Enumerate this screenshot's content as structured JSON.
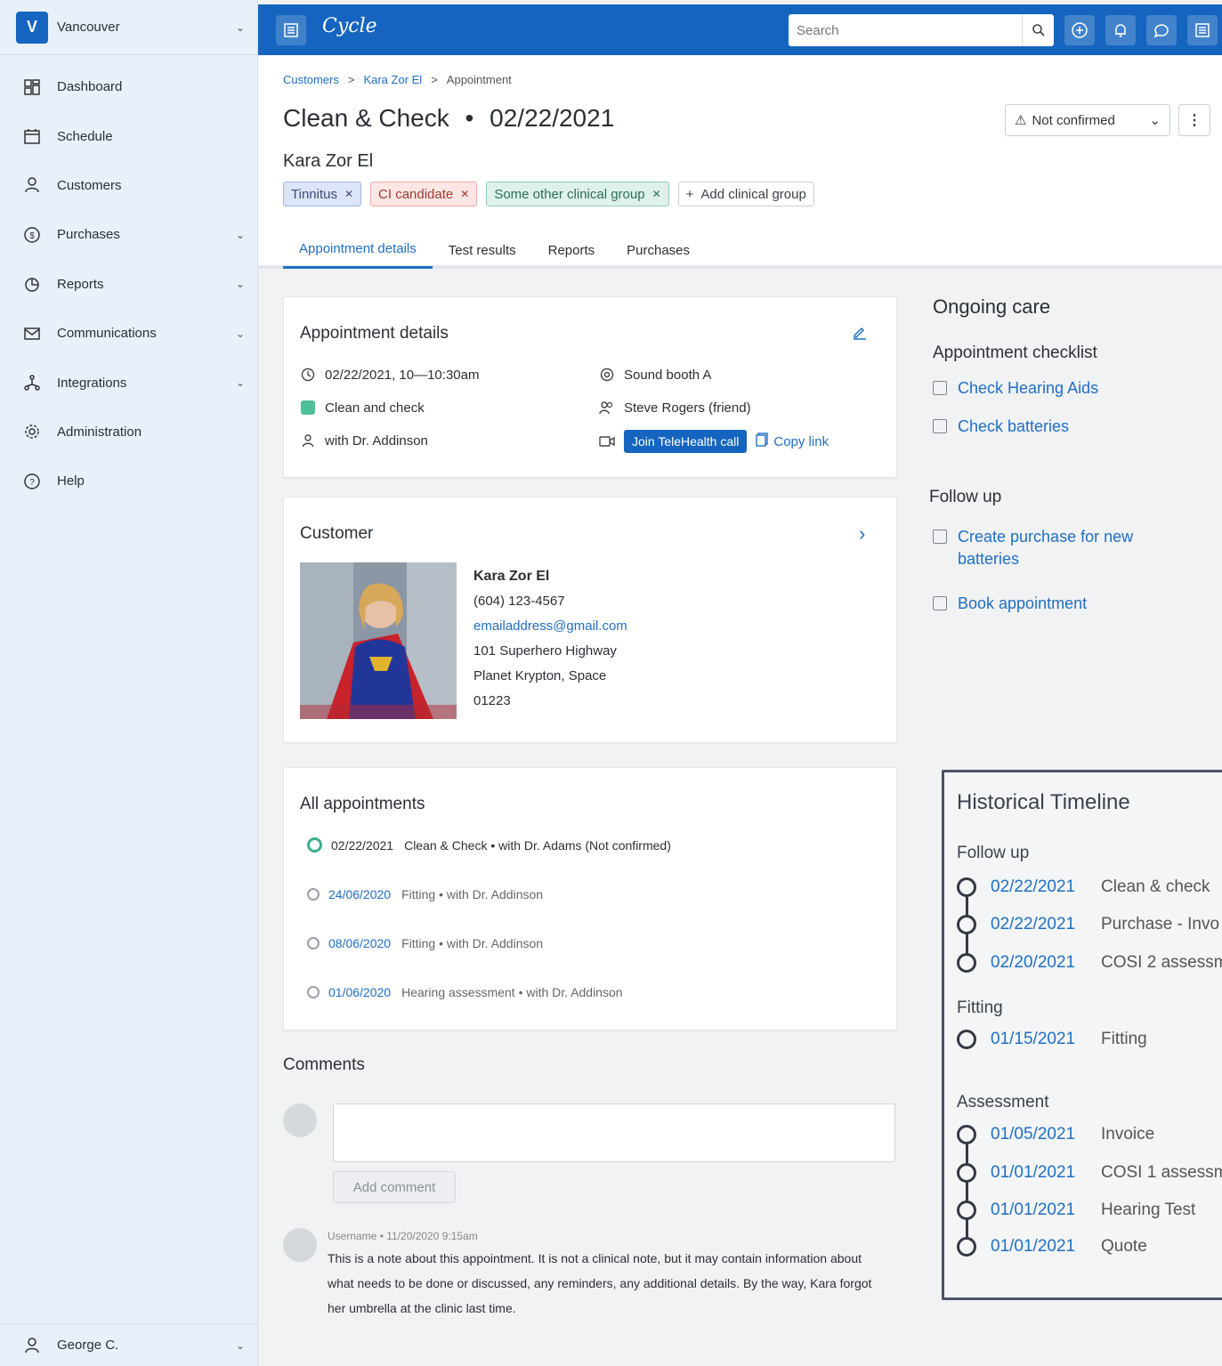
{
  "sidebar": {
    "location_badge": "V",
    "location_name": "Vancouver",
    "items": [
      {
        "label": "Dashboard"
      },
      {
        "label": "Schedule"
      },
      {
        "label": "Customers"
      },
      {
        "label": "Purchases"
      },
      {
        "label": "Reports"
      },
      {
        "label": "Communications"
      },
      {
        "label": "Integrations"
      },
      {
        "label": "Administration"
      },
      {
        "label": "Help"
      }
    ],
    "user_name": "George C."
  },
  "topbar": {
    "logo_text": "Cycle",
    "search_placeholder": "Search"
  },
  "breadcrumb": {
    "items": [
      "Customers",
      "Kara Zor El",
      "Appointment"
    ],
    "separator": ">"
  },
  "header": {
    "title": "Clean & Check",
    "title_sep": "•",
    "title_date": "02/22/2021",
    "customer_name": "Kara Zor El",
    "status": "Not confirmed",
    "more_label": "⋮",
    "tags": [
      {
        "label": "Tinnitus"
      },
      {
        "label": "CI candidate"
      },
      {
        "label": "Some other clinical group"
      }
    ],
    "add_tag_label": "Add clinical group"
  },
  "tabs": [
    {
      "label": "Appointment details"
    },
    {
      "label": "Test results"
    },
    {
      "label": "Reports"
    },
    {
      "label": "Purchases"
    }
  ],
  "appointment_details": {
    "title": "Appointment details",
    "datetime": "02/22/2021, 10—10:30am",
    "type": "Clean and check",
    "type_color": "#4fbf9a",
    "provider": "with Dr. Addinson",
    "room": "Sound booth A",
    "companion": "Steve Rogers (friend)",
    "join_label": "Join TeleHealth call",
    "copy_label": "Copy link"
  },
  "customer": {
    "title": "Customer",
    "name": "Kara Zor El",
    "phone": "(604) 123-4567",
    "email": "emailaddress@gmail.com",
    "address1": "101 Superhero Highway",
    "address2": "Planet Krypton, Space",
    "postal": "01223"
  },
  "all_appointments": {
    "title": "All appointments",
    "items": [
      {
        "date": "02/22/2021",
        "text": "Clean & Check • with Dr. Adams  (Not confirmed)"
      },
      {
        "date": "24/06/2020",
        "text": "Fitting • with Dr. Addinson"
      },
      {
        "date": "08/06/2020",
        "text": "Fitting • with Dr. Addinson"
      },
      {
        "date": "01/06/2020",
        "text": "Hearing assessment • with Dr. Addinson"
      }
    ]
  },
  "comments": {
    "title": "Comments",
    "add_label": "Add comment",
    "items": [
      {
        "meta": "Username • 11/20/2020 9:15am",
        "text": "This is a note about this appointment. It is not a clinical note, but it may contain information about what needs to be done or discussed, any reminders, any additional details. By the way, Kara forgot her umbrella at the clinic last time."
      }
    ]
  },
  "ongoing_care": {
    "title": "Ongoing care",
    "checklist_title": "Appointment checklist",
    "checklist": [
      {
        "label": "Check Hearing Aids"
      },
      {
        "label": "Check batteries"
      }
    ],
    "followup_title": "Follow up",
    "followup": [
      {
        "label": "Create purchase for new batteries"
      },
      {
        "label": "Book appointment"
      }
    ]
  },
  "historical_timeline": {
    "title": "Historical Timeline",
    "groups": [
      {
        "name": "Follow up",
        "items": [
          {
            "date": "02/22/2021",
            "label": "Clean & check"
          },
          {
            "date": "02/22/2021",
            "label": "Purchase - Invo"
          },
          {
            "date": "02/20/2021",
            "label": "COSI 2 assessm"
          }
        ]
      },
      {
        "name": "Fitting",
        "items": [
          {
            "date": "01/15/2021",
            "label": "Fitting"
          }
        ]
      },
      {
        "name": "Assessment",
        "items": [
          {
            "date": "01/05/2021",
            "label": "Invoice"
          },
          {
            "date": "01/01/2021",
            "label": "COSI 1 assessm"
          },
          {
            "date": "01/01/2021",
            "label": "Hearing Test"
          },
          {
            "date": "01/01/2021",
            "label": "Quote"
          }
        ]
      }
    ]
  }
}
